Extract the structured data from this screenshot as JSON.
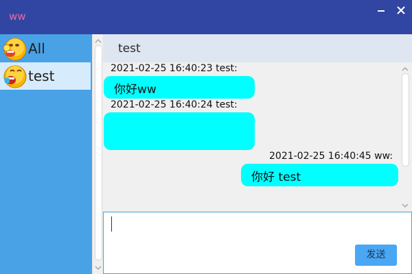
{
  "window": {
    "title": "ww",
    "minimize_icon": "minimize-icon",
    "close_icon": "close-icon"
  },
  "sidebar": {
    "contacts": [
      {
        "name": "All",
        "avatar": "emoji-face-avatar",
        "selected": false
      },
      {
        "name": "test",
        "avatar": "emoji-face-avatar",
        "selected": true
      }
    ]
  },
  "chat": {
    "title": "test",
    "messages": [
      {
        "meta": "2021-02-25 16:40:23 test:",
        "text": "你好ww",
        "side": "left"
      },
      {
        "meta": "2021-02-25 16:40:24 test:",
        "text": "",
        "side": "left"
      },
      {
        "meta": "2021-02-25 16:40:45 ww:",
        "text": "你好 test",
        "side": "right"
      }
    ]
  },
  "input": {
    "value": "",
    "send_label": "发送"
  },
  "colors": {
    "titlebar": "#3046a2",
    "sidebar": "#49a1e6",
    "selected_contact": "#d6ebfb",
    "bubble": "#00ffff",
    "send_button": "#4aa7f4"
  }
}
